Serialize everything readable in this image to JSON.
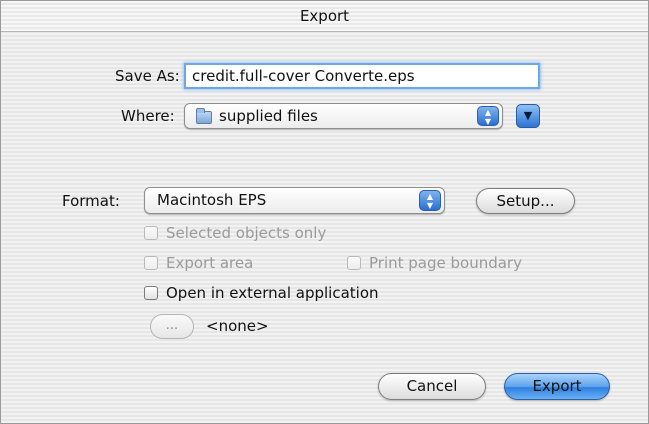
{
  "window": {
    "title": "Export"
  },
  "save_as": {
    "label": "Save As:",
    "value": "credit.full-cover Converte.eps"
  },
  "where": {
    "label": "Where:",
    "value": "supplied files"
  },
  "format": {
    "label": "Format:",
    "value": "Macintosh EPS",
    "setup_label": "Setup..."
  },
  "options": {
    "selected_objects_only": {
      "label": "Selected objects only",
      "checked": false,
      "enabled": false
    },
    "export_area": {
      "label": "Export area",
      "checked": false,
      "enabled": false
    },
    "print_page_boundary": {
      "label": "Print page boundary",
      "checked": false,
      "enabled": false
    },
    "open_in_external_application": {
      "label": "Open in external application",
      "checked": false,
      "enabled": true
    }
  },
  "application": {
    "browse_label": "...",
    "value": "<none>"
  },
  "buttons": {
    "cancel_label": "Cancel",
    "export_label": "Export"
  },
  "colors": {
    "accent": "#3a83e0",
    "focus_ring": "#6fa7e2"
  },
  "icons": {
    "folder": "folder-icon",
    "popup_arrows": "up-down-arrows-icon",
    "expand": "triangle-down-icon"
  }
}
